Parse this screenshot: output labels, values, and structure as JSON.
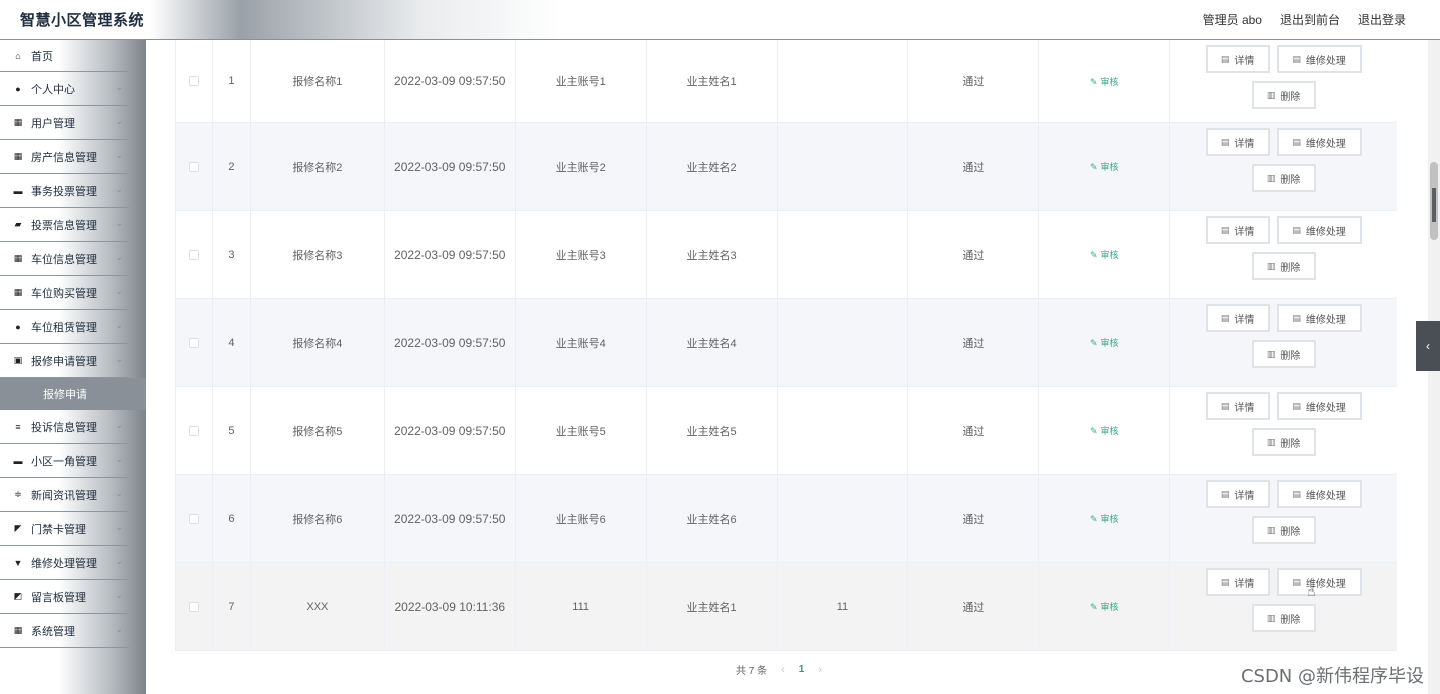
{
  "header": {
    "title": "智慧小区管理系统",
    "admin_label": "管理员 abo",
    "to_frontend": "退出到前台",
    "logout": "退出登录"
  },
  "sidebar": {
    "items": [
      {
        "label": "首页",
        "icon": "home-icon",
        "glyph": "⌂",
        "expandable": false
      },
      {
        "label": "个人中心",
        "icon": "user-icon",
        "glyph": "●",
        "expandable": true
      },
      {
        "label": "用户管理",
        "icon": "grid-icon",
        "glyph": "▦",
        "expandable": true
      },
      {
        "label": "房产信息管理",
        "icon": "apps-icon",
        "glyph": "▦",
        "expandable": true
      },
      {
        "label": "事务投票管理",
        "icon": "briefcase-icon",
        "glyph": "▬",
        "expandable": true
      },
      {
        "label": "投票信息管理",
        "icon": "wallet-icon",
        "glyph": "▰",
        "expandable": true
      },
      {
        "label": "车位信息管理",
        "icon": "grid-icon",
        "glyph": "▦",
        "expandable": true
      },
      {
        "label": "车位购买管理",
        "icon": "grid-icon",
        "glyph": "▦",
        "expandable": true
      },
      {
        "label": "车位租赁管理",
        "icon": "pin-icon",
        "glyph": "●",
        "expandable": true
      },
      {
        "label": "报修申请管理",
        "icon": "clipboard-icon",
        "glyph": "▣",
        "expandable": true
      }
    ],
    "active_sub": "报修申请",
    "items_after": [
      {
        "label": "投诉信息管理",
        "icon": "list-icon",
        "glyph": "≡",
        "expandable": true
      },
      {
        "label": "小区一角管理",
        "icon": "ticket-icon",
        "glyph": "▬",
        "expandable": true
      },
      {
        "label": "新闻资讯管理",
        "icon": "sliders-icon",
        "glyph": "≑",
        "expandable": true
      },
      {
        "label": "门禁卡管理",
        "icon": "send-icon",
        "glyph": "◤",
        "expandable": true
      },
      {
        "label": "维修处理管理",
        "icon": "hammer-icon",
        "glyph": "▼",
        "expandable": true
      },
      {
        "label": "留言板管理",
        "icon": "chart-icon",
        "glyph": "◩",
        "expandable": true
      },
      {
        "label": "系统管理",
        "icon": "grid-icon",
        "glyph": "▦",
        "expandable": true
      }
    ]
  },
  "table": {
    "rows": [
      {
        "index": "1",
        "name": "报修名称1",
        "time": "2022-03-09 09:57:50",
        "account": "业主账号1",
        "owner": "业主姓名1",
        "extra": "",
        "status": "通过"
      },
      {
        "index": "2",
        "name": "报修名称2",
        "time": "2022-03-09 09:57:50",
        "account": "业主账号2",
        "owner": "业主姓名2",
        "extra": "",
        "status": "通过"
      },
      {
        "index": "3",
        "name": "报修名称3",
        "time": "2022-03-09 09:57:50",
        "account": "业主账号3",
        "owner": "业主姓名3",
        "extra": "",
        "status": "通过"
      },
      {
        "index": "4",
        "name": "报修名称4",
        "time": "2022-03-09 09:57:50",
        "account": "业主账号4",
        "owner": "业主姓名4",
        "extra": "",
        "status": "通过"
      },
      {
        "index": "5",
        "name": "报修名称5",
        "time": "2022-03-09 09:57:50",
        "account": "业主账号5",
        "owner": "业主姓名5",
        "extra": "",
        "status": "通过"
      },
      {
        "index": "6",
        "name": "报修名称6",
        "time": "2022-03-09 09:57:50",
        "account": "业主账号6",
        "owner": "业主姓名6",
        "extra": "",
        "status": "通过"
      },
      {
        "index": "7",
        "name": "XXX",
        "time": "2022-03-09 10:11:36",
        "account": "111",
        "owner": "业主姓名1",
        "extra": "11",
        "status": "通过"
      }
    ],
    "audit_label": "审核",
    "detail_label": "详情",
    "repair_label": "维修处理",
    "delete_label": "删除"
  },
  "pagination": {
    "total": "共 7 条",
    "current_page": "1",
    "prev": "‹",
    "next": "›"
  },
  "watermark": "CSDN @新伟程序毕设",
  "collapse_glyph": "‹"
}
